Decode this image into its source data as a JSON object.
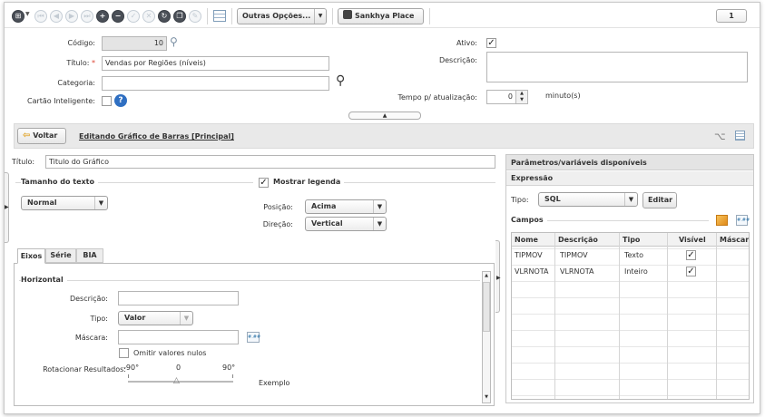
{
  "toolbar": {
    "outras_label": "Outras Opções...",
    "place_label": "Sankhya Place",
    "counter": "1"
  },
  "form": {
    "codigo_label": "Código:",
    "codigo_value": "10",
    "titulo_label": "Título:",
    "titulo_value": "Vendas por Regiões (níveis)",
    "categoria_label": "Categoria:",
    "cartao_label": "Cartão Inteligente:",
    "ativo_label": "Ativo:",
    "descricao_label": "Descrição:",
    "tempo_label": "Tempo p/ atualização:",
    "tempo_value": "0",
    "tempo_unit": "minuto(s)",
    "required_mark": "*"
  },
  "nav": {
    "voltar_label": "Voltar",
    "edit_title": "Editando Gráfico de Barras [Principal]"
  },
  "left": {
    "titulo_label": "Título:",
    "titulo_value": "Titulo do Gráfico",
    "tamanho_label": "Tamanho do texto",
    "tamanho_value": "Normal",
    "mostrar_legenda_label": "Mostrar legenda",
    "posicao_label": "Posição:",
    "posicao_value": "Acima",
    "direcao_label": "Direção:",
    "direcao_value": "Vertical",
    "tabs": [
      {
        "label": "Eixos"
      },
      {
        "label": "Série"
      },
      {
        "label": "BIA"
      }
    ],
    "horizontal_label": "Horizontal",
    "descricao_label": "Descrição:",
    "tipo_label": "Tipo:",
    "tipo_value": "Valor",
    "mascara_label": "Máscara:",
    "mask_icon_text": "#.##",
    "omitir_label": "Omitir valores nulos",
    "rotacionar_label": "Rotacionar Resultados:",
    "rot_ticks": [
      "-90°",
      "0",
      "90°"
    ],
    "rot_value": 0,
    "exemplo_label": "Exemplo"
  },
  "right": {
    "params_title": "Parâmetros/variáveis disponíveis",
    "expressao_label": "Expressão",
    "tipo_label": "Tipo:",
    "tipo_value": "SQL",
    "editar_label": "Editar",
    "campos_label": "Campos",
    "columns": [
      "Nome",
      "Descrição",
      "Tipo",
      "Visível",
      "Máscara"
    ],
    "rows": [
      {
        "nome": "TIPMOV",
        "descricao": "TIPMOV",
        "tipo": "Texto",
        "visivel": true
      },
      {
        "nome": "VLRNOTA",
        "descricao": "VLRNOTA",
        "tipo": "Inteiro",
        "visivel": true
      }
    ]
  }
}
